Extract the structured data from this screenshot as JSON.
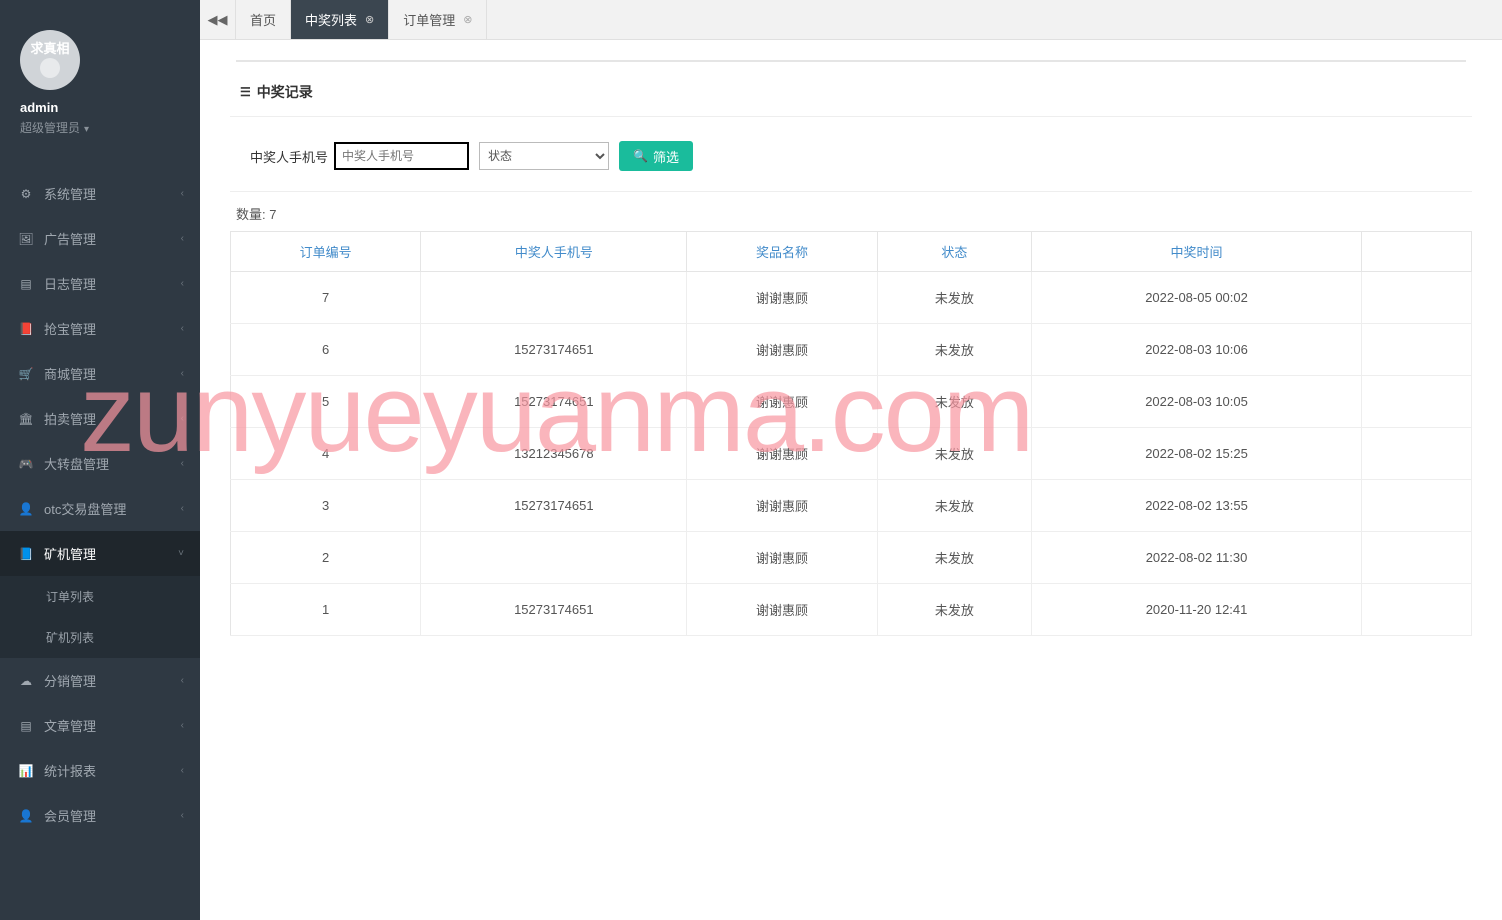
{
  "profile": {
    "avatar_text": "求真相",
    "username": "admin",
    "role": "超级管理员"
  },
  "sidebar": {
    "items": [
      {
        "icon": "⚙",
        "label": "系统管理",
        "expandable": true
      },
      {
        "icon": "🖼",
        "label": "广告管理",
        "expandable": true
      },
      {
        "icon": "▤",
        "label": "日志管理",
        "expandable": true
      },
      {
        "icon": "📕",
        "label": "抢宝管理",
        "expandable": true
      },
      {
        "icon": "🛒",
        "label": "商城管理",
        "expandable": true
      },
      {
        "icon": "🏛",
        "label": "拍卖管理",
        "expandable": true
      },
      {
        "icon": "🎮",
        "label": "大转盘管理",
        "expandable": true
      },
      {
        "icon": "👤",
        "label": "otc交易盘管理",
        "expandable": true
      },
      {
        "icon": "📘",
        "label": "矿机管理",
        "expandable": true,
        "active": true,
        "expanded": true,
        "subitems": [
          {
            "label": "订单列表"
          },
          {
            "label": "矿机列表"
          }
        ]
      },
      {
        "icon": "☁",
        "label": "分销管理",
        "expandable": true
      },
      {
        "icon": "▤",
        "label": "文章管理",
        "expandable": true
      },
      {
        "icon": "📊",
        "label": "统计报表",
        "expandable": true
      },
      {
        "icon": "👤",
        "label": "会员管理",
        "expandable": true
      }
    ]
  },
  "tabs": {
    "home_icon": "◀◀",
    "items": [
      {
        "label": "首页",
        "closable": false
      },
      {
        "label": "中奖列表",
        "closable": true,
        "active": true
      },
      {
        "label": "订单管理",
        "closable": true
      }
    ]
  },
  "panel": {
    "title_icon": "☰",
    "title": "中奖记录"
  },
  "filter": {
    "phone_label": "中奖人手机号",
    "phone_placeholder": "中奖人手机号",
    "status_selected": "状态",
    "button_icon": "🔍",
    "button_label": "筛选"
  },
  "count": {
    "label": "数量:",
    "value": "7"
  },
  "table": {
    "headers": [
      "订单编号",
      "中奖人手机号",
      "奖品名称",
      "状态",
      "中奖时间",
      ""
    ],
    "rows": [
      {
        "id": "7",
        "phone": "",
        "prize": "谢谢惠顾",
        "status": "未发放",
        "time": "2022-08-05 00:02"
      },
      {
        "id": "6",
        "phone": "15273174651",
        "prize": "谢谢惠顾",
        "status": "未发放",
        "time": "2022-08-03 10:06"
      },
      {
        "id": "5",
        "phone": "15273174651",
        "prize": "谢谢惠顾",
        "status": "未发放",
        "time": "2022-08-03 10:05"
      },
      {
        "id": "4",
        "phone": "13212345678",
        "prize": "谢谢惠顾",
        "status": "未发放",
        "time": "2022-08-02 15:25"
      },
      {
        "id": "3",
        "phone": "15273174651",
        "prize": "谢谢惠顾",
        "status": "未发放",
        "time": "2022-08-02 13:55"
      },
      {
        "id": "2",
        "phone": "",
        "prize": "谢谢惠顾",
        "status": "未发放",
        "time": "2022-08-02 11:30"
      },
      {
        "id": "1",
        "phone": "15273174651",
        "prize": "谢谢惠顾",
        "status": "未发放",
        "time": "2020-11-20 12:41"
      }
    ]
  },
  "watermark": "zunyueyuanma.com"
}
